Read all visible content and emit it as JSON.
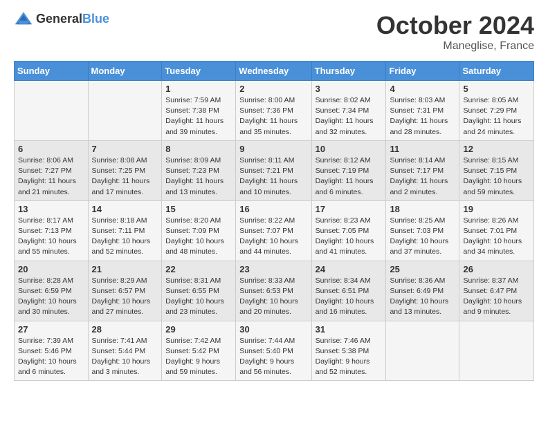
{
  "header": {
    "logo_general": "General",
    "logo_blue": "Blue",
    "month_title": "October 2024",
    "location": "Maneglise, France"
  },
  "columns": [
    "Sunday",
    "Monday",
    "Tuesday",
    "Wednesday",
    "Thursday",
    "Friday",
    "Saturday"
  ],
  "weeks": [
    [
      {
        "day": "",
        "info": ""
      },
      {
        "day": "",
        "info": ""
      },
      {
        "day": "1",
        "info": "Sunrise: 7:59 AM\nSunset: 7:38 PM\nDaylight: 11 hours and 39 minutes."
      },
      {
        "day": "2",
        "info": "Sunrise: 8:00 AM\nSunset: 7:36 PM\nDaylight: 11 hours and 35 minutes."
      },
      {
        "day": "3",
        "info": "Sunrise: 8:02 AM\nSunset: 7:34 PM\nDaylight: 11 hours and 32 minutes."
      },
      {
        "day": "4",
        "info": "Sunrise: 8:03 AM\nSunset: 7:31 PM\nDaylight: 11 hours and 28 minutes."
      },
      {
        "day": "5",
        "info": "Sunrise: 8:05 AM\nSunset: 7:29 PM\nDaylight: 11 hours and 24 minutes."
      }
    ],
    [
      {
        "day": "6",
        "info": "Sunrise: 8:06 AM\nSunset: 7:27 PM\nDaylight: 11 hours and 21 minutes."
      },
      {
        "day": "7",
        "info": "Sunrise: 8:08 AM\nSunset: 7:25 PM\nDaylight: 11 hours and 17 minutes."
      },
      {
        "day": "8",
        "info": "Sunrise: 8:09 AM\nSunset: 7:23 PM\nDaylight: 11 hours and 13 minutes."
      },
      {
        "day": "9",
        "info": "Sunrise: 8:11 AM\nSunset: 7:21 PM\nDaylight: 11 hours and 10 minutes."
      },
      {
        "day": "10",
        "info": "Sunrise: 8:12 AM\nSunset: 7:19 PM\nDaylight: 11 hours and 6 minutes."
      },
      {
        "day": "11",
        "info": "Sunrise: 8:14 AM\nSunset: 7:17 PM\nDaylight: 11 hours and 2 minutes."
      },
      {
        "day": "12",
        "info": "Sunrise: 8:15 AM\nSunset: 7:15 PM\nDaylight: 10 hours and 59 minutes."
      }
    ],
    [
      {
        "day": "13",
        "info": "Sunrise: 8:17 AM\nSunset: 7:13 PM\nDaylight: 10 hours and 55 minutes."
      },
      {
        "day": "14",
        "info": "Sunrise: 8:18 AM\nSunset: 7:11 PM\nDaylight: 10 hours and 52 minutes."
      },
      {
        "day": "15",
        "info": "Sunrise: 8:20 AM\nSunset: 7:09 PM\nDaylight: 10 hours and 48 minutes."
      },
      {
        "day": "16",
        "info": "Sunrise: 8:22 AM\nSunset: 7:07 PM\nDaylight: 10 hours and 44 minutes."
      },
      {
        "day": "17",
        "info": "Sunrise: 8:23 AM\nSunset: 7:05 PM\nDaylight: 10 hours and 41 minutes."
      },
      {
        "day": "18",
        "info": "Sunrise: 8:25 AM\nSunset: 7:03 PM\nDaylight: 10 hours and 37 minutes."
      },
      {
        "day": "19",
        "info": "Sunrise: 8:26 AM\nSunset: 7:01 PM\nDaylight: 10 hours and 34 minutes."
      }
    ],
    [
      {
        "day": "20",
        "info": "Sunrise: 8:28 AM\nSunset: 6:59 PM\nDaylight: 10 hours and 30 minutes."
      },
      {
        "day": "21",
        "info": "Sunrise: 8:29 AM\nSunset: 6:57 PM\nDaylight: 10 hours and 27 minutes."
      },
      {
        "day": "22",
        "info": "Sunrise: 8:31 AM\nSunset: 6:55 PM\nDaylight: 10 hours and 23 minutes."
      },
      {
        "day": "23",
        "info": "Sunrise: 8:33 AM\nSunset: 6:53 PM\nDaylight: 10 hours and 20 minutes."
      },
      {
        "day": "24",
        "info": "Sunrise: 8:34 AM\nSunset: 6:51 PM\nDaylight: 10 hours and 16 minutes."
      },
      {
        "day": "25",
        "info": "Sunrise: 8:36 AM\nSunset: 6:49 PM\nDaylight: 10 hours and 13 minutes."
      },
      {
        "day": "26",
        "info": "Sunrise: 8:37 AM\nSunset: 6:47 PM\nDaylight: 10 hours and 9 minutes."
      }
    ],
    [
      {
        "day": "27",
        "info": "Sunrise: 7:39 AM\nSunset: 5:46 PM\nDaylight: 10 hours and 6 minutes."
      },
      {
        "day": "28",
        "info": "Sunrise: 7:41 AM\nSunset: 5:44 PM\nDaylight: 10 hours and 3 minutes."
      },
      {
        "day": "29",
        "info": "Sunrise: 7:42 AM\nSunset: 5:42 PM\nDaylight: 9 hours and 59 minutes."
      },
      {
        "day": "30",
        "info": "Sunrise: 7:44 AM\nSunset: 5:40 PM\nDaylight: 9 hours and 56 minutes."
      },
      {
        "day": "31",
        "info": "Sunrise: 7:46 AM\nSunset: 5:38 PM\nDaylight: 9 hours and 52 minutes."
      },
      {
        "day": "",
        "info": ""
      },
      {
        "day": "",
        "info": ""
      }
    ]
  ]
}
